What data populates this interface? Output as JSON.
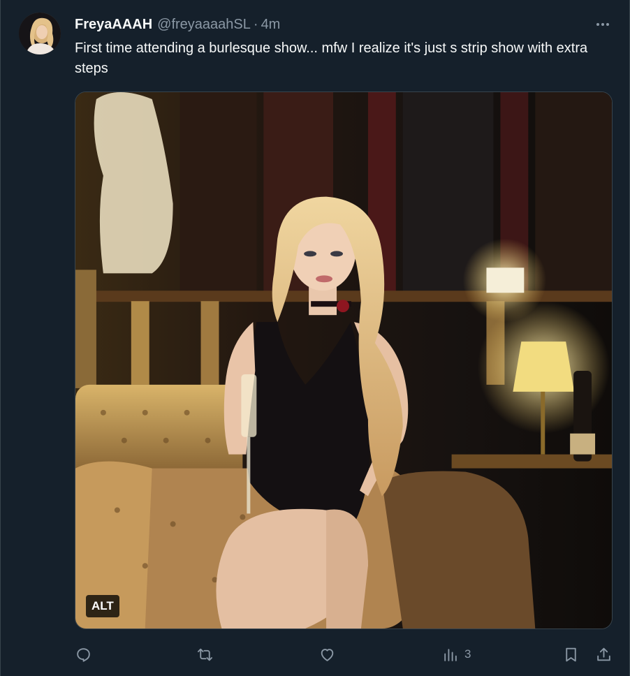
{
  "tweet": {
    "display_name": "FreyaAAAH",
    "handle": "@freyaaaahSL",
    "separator": "·",
    "timestamp": "4m",
    "text": "First time attending a burlesque show... mfw I realize it's just s strip show with extra steps",
    "media_alt_badge": "ALT",
    "more_icon": "more-horizontal-icon"
  },
  "actions": {
    "reply_icon": "reply-icon",
    "retweet_icon": "retweet-icon",
    "like_icon": "heart-icon",
    "views_icon": "views-chart-icon",
    "views_count": "3",
    "bookmark_icon": "bookmark-icon",
    "share_icon": "share-icon"
  },
  "colors": {
    "background": "#15202b",
    "text_primary": "#f7f9f9",
    "text_secondary": "#8b98a5",
    "border": "#38444d"
  }
}
